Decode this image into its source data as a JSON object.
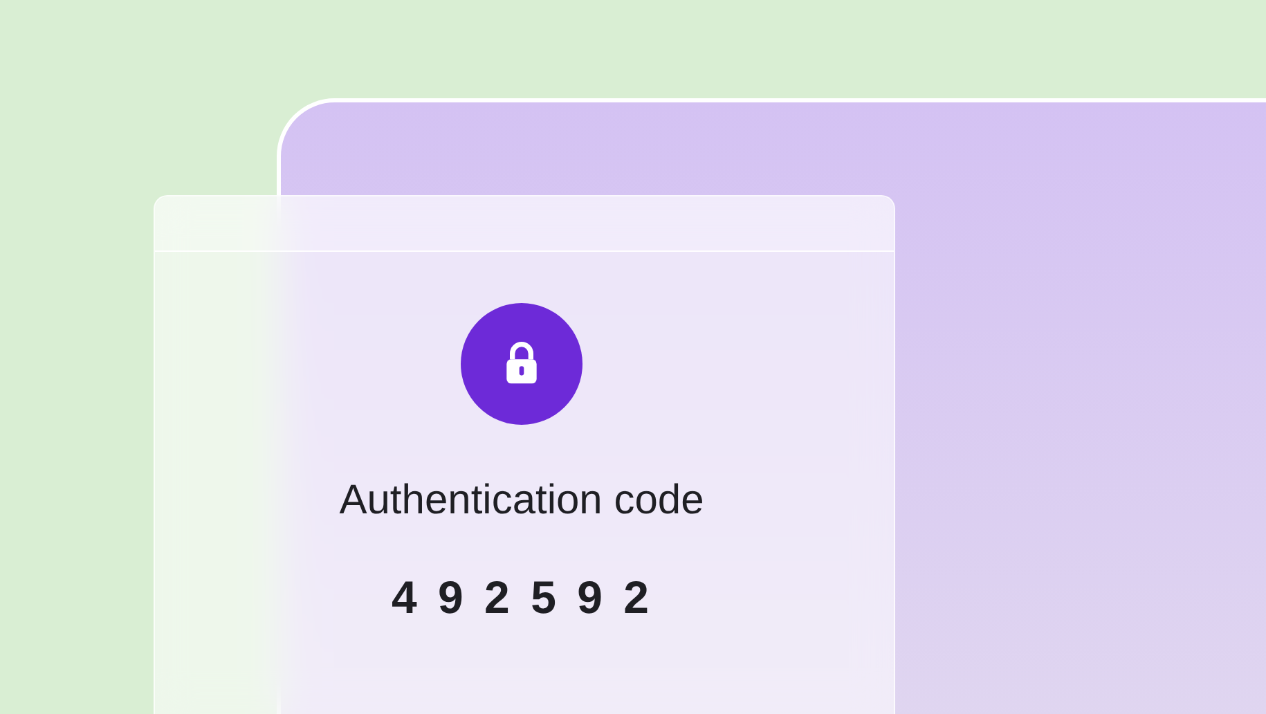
{
  "card": {
    "title": "Authentication code",
    "code": "4 9 2 5 9 2"
  }
}
